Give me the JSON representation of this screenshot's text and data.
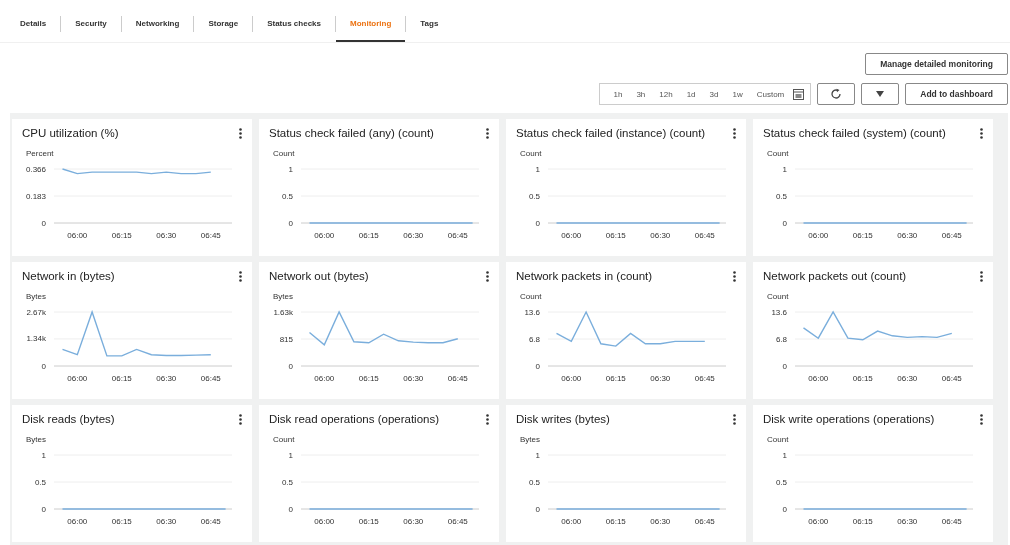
{
  "tabs": [
    {
      "label": "Details",
      "selected": false
    },
    {
      "label": "Security",
      "selected": false
    },
    {
      "label": "Networking",
      "selected": false
    },
    {
      "label": "Storage",
      "selected": false
    },
    {
      "label": "Status checks",
      "selected": false
    },
    {
      "label": "Monitoring",
      "selected": true
    },
    {
      "label": "Tags",
      "selected": false
    }
  ],
  "manage_button": "Manage detailed monitoring",
  "time_ranges": [
    {
      "label": "1h",
      "selected": false
    },
    {
      "label": "3h",
      "selected": false
    },
    {
      "label": "12h",
      "selected": false
    },
    {
      "label": "1d",
      "selected": false
    },
    {
      "label": "3d",
      "selected": false
    },
    {
      "label": "1w",
      "selected": false
    },
    {
      "label": "Custom",
      "selected": false
    }
  ],
  "add_button": "Add to dashboard",
  "widgets": [
    {
      "title": "CPU utilization (%)",
      "chart_data": {
        "type": "line",
        "ylabel": "Percent",
        "categories": [
          null,
          "06:00",
          null,
          null,
          "06:15",
          null,
          null,
          "06:30",
          null,
          null,
          "06:45",
          null
        ],
        "ylim": [
          0,
          0.366
        ],
        "yticks": [
          0,
          0.183,
          0.366
        ],
        "series": [
          {
            "color": "#7aaedc",
            "values": [
              0.366,
              0.335,
              0.345,
              0.345,
              0.345,
              0.345,
              0.335,
              0.345,
              0.335,
              0.335,
              0.345,
              null
            ]
          }
        ]
      }
    },
    {
      "title": "Status check failed (any) (count)",
      "chart_data": {
        "type": "line",
        "ylabel": "Count",
        "categories": [
          null,
          "06:00",
          null,
          null,
          "06:15",
          null,
          null,
          "06:30",
          null,
          null,
          "06:45",
          null
        ],
        "ylim": [
          0,
          1
        ],
        "yticks": [
          0,
          0.5,
          1
        ],
        "series": [
          {
            "color": "#7aaedc",
            "values": [
              0,
              0,
              0,
              0,
              0,
              0,
              0,
              0,
              0,
              0,
              0,
              0
            ]
          }
        ]
      }
    },
    {
      "title": "Status check failed (instance) (count)",
      "chart_data": {
        "type": "line",
        "ylabel": "Count",
        "categories": [
          null,
          "06:00",
          null,
          null,
          "06:15",
          null,
          null,
          "06:30",
          null,
          null,
          "06:45",
          null
        ],
        "ylim": [
          0,
          1
        ],
        "yticks": [
          0,
          0.5,
          1
        ],
        "series": [
          {
            "color": "#7aaedc",
            "values": [
              0,
              0,
              0,
              0,
              0,
              0,
              0,
              0,
              0,
              0,
              0,
              0
            ]
          }
        ]
      }
    },
    {
      "title": "Status check failed (system) (count)",
      "chart_data": {
        "type": "line",
        "ylabel": "Count",
        "categories": [
          null,
          "06:00",
          null,
          null,
          "06:15",
          null,
          null,
          "06:30",
          null,
          null,
          "06:45",
          null
        ],
        "ylim": [
          0,
          1
        ],
        "yticks": [
          0,
          0.5,
          1
        ],
        "series": [
          {
            "color": "#7aaedc",
            "values": [
              0,
              0,
              0,
              0,
              0,
              0,
              0,
              0,
              0,
              0,
              0,
              0
            ]
          }
        ]
      }
    },
    {
      "title": "Network in (bytes)",
      "chart_data": {
        "type": "line",
        "ylabel": "Bytes",
        "categories": [
          null,
          "06:00",
          null,
          null,
          "06:15",
          null,
          null,
          "06:30",
          null,
          null,
          "06:45",
          null
        ],
        "ylim": [
          0,
          2670
        ],
        "yticks": [
          0,
          {
            "value": 1340,
            "label": "1.34k"
          },
          {
            "value": 2670,
            "label": "2.67k"
          }
        ],
        "series": [
          {
            "color": "#7aaedc",
            "values": [
              820,
              560,
              2670,
              500,
              500,
              820,
              560,
              520,
              520,
              540,
              560,
              null
            ]
          }
        ]
      }
    },
    {
      "title": "Network out (bytes)",
      "chart_data": {
        "type": "line",
        "ylabel": "Bytes",
        "categories": [
          null,
          "06:00",
          null,
          null,
          "06:15",
          null,
          null,
          "06:30",
          null,
          null,
          "06:45",
          null
        ],
        "ylim": [
          0,
          1630
        ],
        "yticks": [
          0,
          815,
          {
            "value": 1630,
            "label": "1.63k"
          }
        ],
        "series": [
          {
            "color": "#7aaedc",
            "values": [
              1010,
              640,
              1630,
              730,
              700,
              960,
              760,
              720,
              700,
              700,
              820,
              null
            ]
          }
        ]
      }
    },
    {
      "title": "Network packets in (count)",
      "chart_data": {
        "type": "line",
        "ylabel": "Count",
        "categories": [
          null,
          "06:00",
          null,
          null,
          "06:15",
          null,
          null,
          "06:30",
          null,
          null,
          "06:45",
          null
        ],
        "ylim": [
          0,
          13.6
        ],
        "yticks": [
          0,
          6.8,
          13.6
        ],
        "series": [
          {
            "color": "#7aaedc",
            "values": [
              8.2,
              6.2,
              13.6,
              5.6,
              5,
              8.2,
              5.6,
              5.6,
              6.2,
              6.2,
              6.2,
              null
            ]
          }
        ]
      }
    },
    {
      "title": "Network packets out (count)",
      "chart_data": {
        "type": "line",
        "ylabel": "Count",
        "categories": [
          null,
          "06:00",
          null,
          null,
          "06:15",
          null,
          null,
          "06:30",
          null,
          null,
          "06:45",
          null
        ],
        "ylim": [
          0,
          13.6
        ],
        "yticks": [
          0,
          6.8,
          13.6
        ],
        "series": [
          {
            "color": "#7aaedc",
            "values": [
              9.6,
              7,
              13.6,
              7,
              6.6,
              8.8,
              7.6,
              7.2,
              7.4,
              7.2,
              8.2,
              null
            ]
          }
        ]
      }
    },
    {
      "title": "Disk reads (bytes)",
      "chart_data": {
        "type": "line",
        "ylabel": "Bytes",
        "categories": [
          null,
          "06:00",
          null,
          null,
          "06:15",
          null,
          null,
          "06:30",
          null,
          null,
          "06:45",
          null
        ],
        "ylim": [
          0,
          1
        ],
        "yticks": [
          0,
          0.5,
          1
        ],
        "series": [
          {
            "color": "#7aaedc",
            "values": [
              0,
              0,
              0,
              0,
              0,
              0,
              0,
              0,
              0,
              0,
              0,
              0
            ]
          }
        ]
      }
    },
    {
      "title": "Disk read operations (operations)",
      "chart_data": {
        "type": "line",
        "ylabel": "Count",
        "categories": [
          null,
          "06:00",
          null,
          null,
          "06:15",
          null,
          null,
          "06:30",
          null,
          null,
          "06:45",
          null
        ],
        "ylim": [
          0,
          1
        ],
        "yticks": [
          0,
          0.5,
          1
        ],
        "series": [
          {
            "color": "#7aaedc",
            "values": [
              0,
              0,
              0,
              0,
              0,
              0,
              0,
              0,
              0,
              0,
              0,
              0
            ]
          }
        ]
      }
    },
    {
      "title": "Disk writes (bytes)",
      "chart_data": {
        "type": "line",
        "ylabel": "Bytes",
        "categories": [
          null,
          "06:00",
          null,
          null,
          "06:15",
          null,
          null,
          "06:30",
          null,
          null,
          "06:45",
          null
        ],
        "ylim": [
          0,
          1
        ],
        "yticks": [
          0,
          0.5,
          1
        ],
        "series": [
          {
            "color": "#7aaedc",
            "values": [
              0,
              0,
              0,
              0,
              0,
              0,
              0,
              0,
              0,
              0,
              0,
              0
            ]
          }
        ]
      }
    },
    {
      "title": "Disk write operations (operations)",
      "chart_data": {
        "type": "line",
        "ylabel": "Count",
        "categories": [
          null,
          "06:00",
          null,
          null,
          "06:15",
          null,
          null,
          "06:30",
          null,
          null,
          "06:45",
          null
        ],
        "ylim": [
          0,
          1
        ],
        "yticks": [
          0,
          0.5,
          1
        ],
        "series": [
          {
            "color": "#7aaedc",
            "values": [
              0,
              0,
              0,
              0,
              0,
              0,
              0,
              0,
              0,
              0,
              0,
              0
            ]
          }
        ]
      }
    }
  ]
}
